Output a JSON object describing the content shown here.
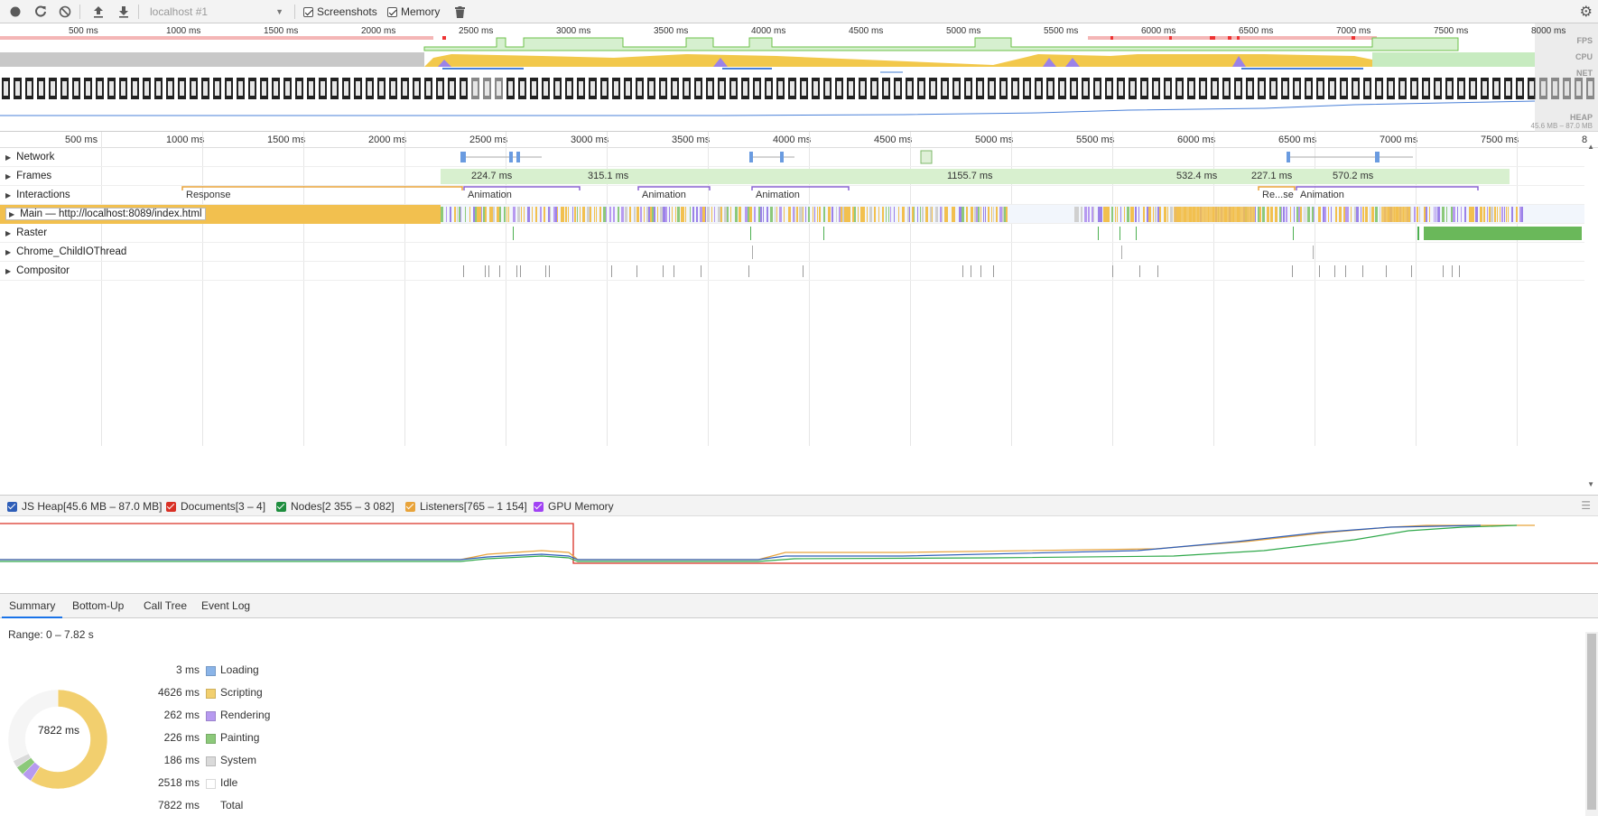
{
  "toolbar": {
    "target": "localhost #1",
    "screenshots_label": "Screenshots",
    "memory_label": "Memory",
    "icons": [
      "record-icon",
      "reload-icon",
      "clear-icon",
      "upload-icon",
      "download-icon",
      "trash-icon",
      "gear-icon"
    ]
  },
  "overview": {
    "ticks": [
      "500 ms",
      "1000 ms",
      "1500 ms",
      "2000 ms",
      "2500 ms",
      "3000 ms",
      "3500 ms",
      "4000 ms",
      "4500 ms",
      "5000 ms",
      "5500 ms",
      "6000 ms",
      "6500 ms",
      "7000 ms",
      "7500 ms",
      "8000 ms"
    ],
    "labels": {
      "fps": "FPS",
      "cpu": "CPU",
      "net": "NET",
      "heap": "HEAP",
      "heap_range": "45.6 MB – 87.0 MB"
    }
  },
  "ruler": {
    "ticks": [
      "500 ms",
      "1000 ms",
      "1500 ms",
      "2000 ms",
      "2500 ms",
      "3000 ms",
      "3500 ms",
      "4000 ms",
      "4500 ms",
      "5000 ms",
      "5500 ms",
      "6000 ms",
      "6500 ms",
      "7000 ms",
      "7500 ms",
      "8"
    ]
  },
  "tracks": {
    "network": "Network",
    "frames": "Frames",
    "interactions": "Interactions",
    "main": "Main — http://localhost:8089/index.html",
    "raster": "Raster",
    "childio": "Chrome_ChildIOThread",
    "compositor": "Compositor"
  },
  "frames": [
    "224.7 ms",
    "315.1 ms",
    "1155.7 ms",
    "532.4 ms",
    "227.1 ms",
    "570.2 ms"
  ],
  "interactions": [
    "Response",
    "Animation",
    "Animation",
    "Animation",
    "Re...se",
    "Animation"
  ],
  "memory": {
    "items": [
      {
        "label": "JS Heap[45.6 MB – 87.0 MB]",
        "color": "#2e5eb8"
      },
      {
        "label": "Documents[3 – 4]",
        "color": "#d93025"
      },
      {
        "label": "Nodes[2 355 – 3 082]",
        "color": "#1e8e3e"
      },
      {
        "label": "Listeners[765 – 1 154]",
        "color": "#e8a33a"
      },
      {
        "label": "GPU Memory",
        "color": "#a142f4"
      }
    ]
  },
  "tabs": [
    "Summary",
    "Bottom-Up",
    "Call Tree",
    "Event Log"
  ],
  "summary": {
    "range": "Range: 0 – 7.82 s",
    "total_center": "7822 ms",
    "rows": [
      {
        "value": "3 ms",
        "label": "Loading",
        "color": "#8ab4e8"
      },
      {
        "value": "4626 ms",
        "label": "Scripting",
        "color": "#f2cf6e"
      },
      {
        "value": "262 ms",
        "label": "Rendering",
        "color": "#b79af0"
      },
      {
        "value": "226 ms",
        "label": "Painting",
        "color": "#8cc97a"
      },
      {
        "value": "186 ms",
        "label": "System",
        "color": "#dadada"
      },
      {
        "value": "2518 ms",
        "label": "Idle",
        "color": "#ffffff"
      },
      {
        "value": "7822 ms",
        "label": "Total",
        "color": ""
      }
    ]
  }
}
